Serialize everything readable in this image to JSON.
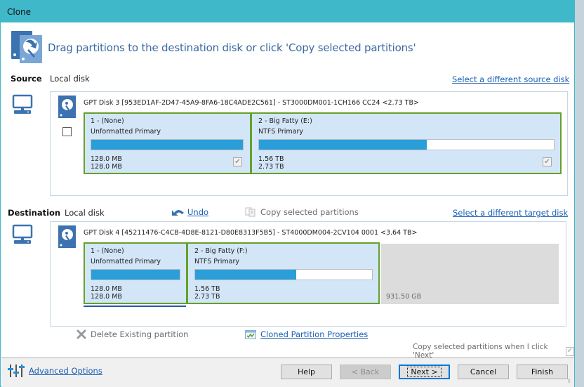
{
  "window": {
    "title": "Clone",
    "accent_color": "#3fb8c9"
  },
  "header": {
    "icon": "clone-disk-icon",
    "instruction": "Drag partitions to the destination disk or click 'Copy selected partitions'"
  },
  "source": {
    "label": "Source",
    "location": "Local disk",
    "select_link": "Select a different source disk",
    "disk": {
      "title": "GPT Disk 3 [953ED1AF-2D47-45A9-8FA6-18C4ADE2C561] - ST3000DM001-1CH166 CC24  <2.73 TB>",
      "select_all_checked": false,
      "partitions": [
        {
          "name": "1 -  (None)",
          "type": "Unformatted Primary",
          "used": "128.0 MB",
          "total": "128.0 MB",
          "used_fraction": 1.0,
          "checked": true
        },
        {
          "name": "2 - Big Fatty (E:)",
          "type": "NTFS Primary",
          "used": "1.56 TB",
          "total": "2.73 TB",
          "used_fraction": 0.57,
          "checked": true
        }
      ]
    }
  },
  "destination": {
    "label": "Destination",
    "location": "Local disk",
    "undo_label": "Undo",
    "copy_label": "Copy selected partitions",
    "select_link": "Select a different target disk",
    "disk": {
      "title": "GPT Disk 4 [45211476-C4CB-4D8E-8121-D80E8313F5B5] - ST4000DM004-2CV104 0001  <3.64 TB>",
      "partitions": [
        {
          "name": "1 -  (None)",
          "type": "Unformatted Primary",
          "used": "128.0 MB",
          "total": "128.0 MB",
          "used_fraction": 1.0
        },
        {
          "name": "2 - Big Fatty (F:)",
          "type": "NTFS Primary",
          "used": "1.56 TB",
          "total": "2.73 TB",
          "used_fraction": 0.57
        }
      ],
      "unallocated": "931.50 GB"
    },
    "delete_label": "Delete Existing partition",
    "properties_label": "Cloned Partition Properties"
  },
  "copy_on_next": {
    "label": "Copy selected partitions when I click 'Next'",
    "checked": true
  },
  "footer": {
    "advanced_label": "Advanced Options",
    "buttons": {
      "help": "Help",
      "back": "< Back",
      "next": "Next >",
      "cancel": "Cancel",
      "finish": "Finish"
    }
  }
}
